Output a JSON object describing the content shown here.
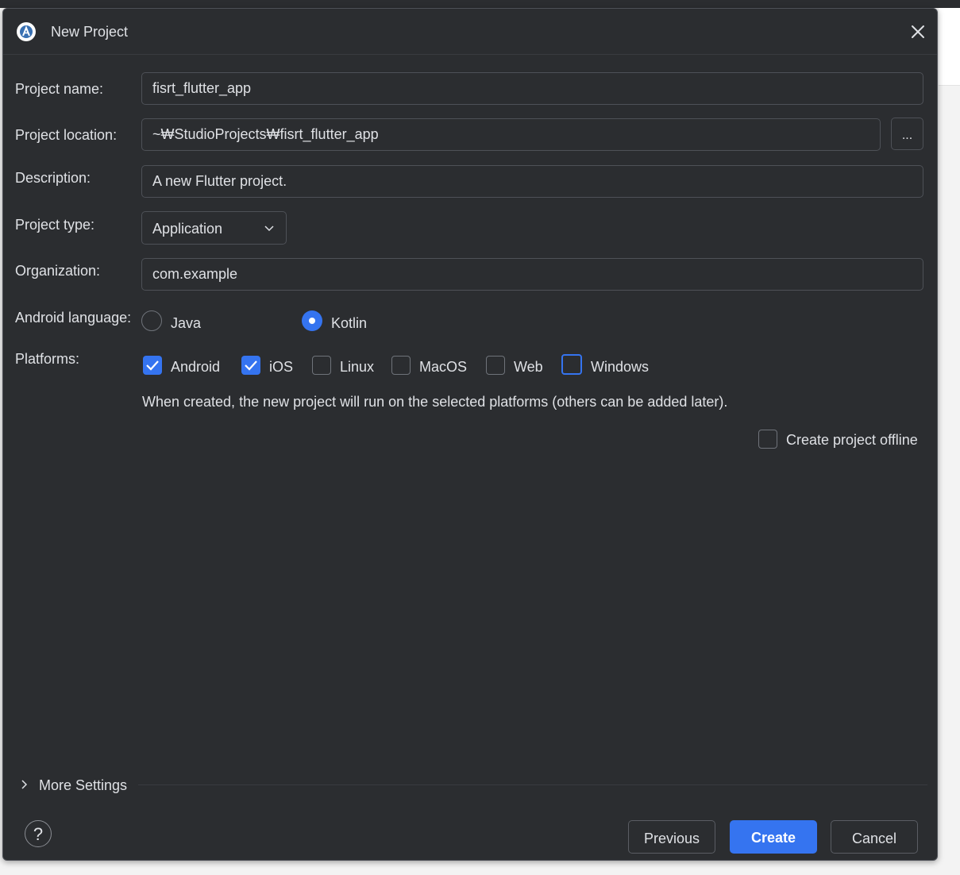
{
  "dialog": {
    "title": "New Project"
  },
  "fields": {
    "project_name": {
      "label": "Project name:",
      "value": "fisrt_flutter_app"
    },
    "project_location": {
      "label": "Project location:",
      "value": "~₩StudioProjects₩fisrt_flutter_app",
      "browse_label": "..."
    },
    "description": {
      "label": "Description:",
      "value": "A new Flutter project."
    },
    "project_type": {
      "label": "Project type:",
      "selected": "Application"
    },
    "organization": {
      "label": "Organization:",
      "value": "com.example"
    }
  },
  "android_language": {
    "label": "Android language:",
    "options": [
      {
        "label": "Java",
        "selected": false
      },
      {
        "label": "Kotlin",
        "selected": true
      }
    ]
  },
  "platforms": {
    "label": "Platforms:",
    "options": [
      {
        "label": "Android",
        "checked": true
      },
      {
        "label": "iOS",
        "checked": true
      },
      {
        "label": "Linux",
        "checked": false
      },
      {
        "label": "MacOS",
        "checked": false
      },
      {
        "label": "Web",
        "checked": false
      },
      {
        "label": "Windows",
        "checked": false,
        "focused": true
      }
    ],
    "hint": "When created, the new project will run on the selected platforms (others can be added later)."
  },
  "offline": {
    "label": "Create project offline",
    "checked": false
  },
  "more_settings": {
    "label": "More Settings"
  },
  "footer": {
    "help": "?",
    "previous": "Previous",
    "create": "Create",
    "cancel": "Cancel"
  },
  "colors": {
    "background": "#2b2d30",
    "border": "#4e5157",
    "text": "#dfe1e5",
    "accent": "#3574f0"
  }
}
